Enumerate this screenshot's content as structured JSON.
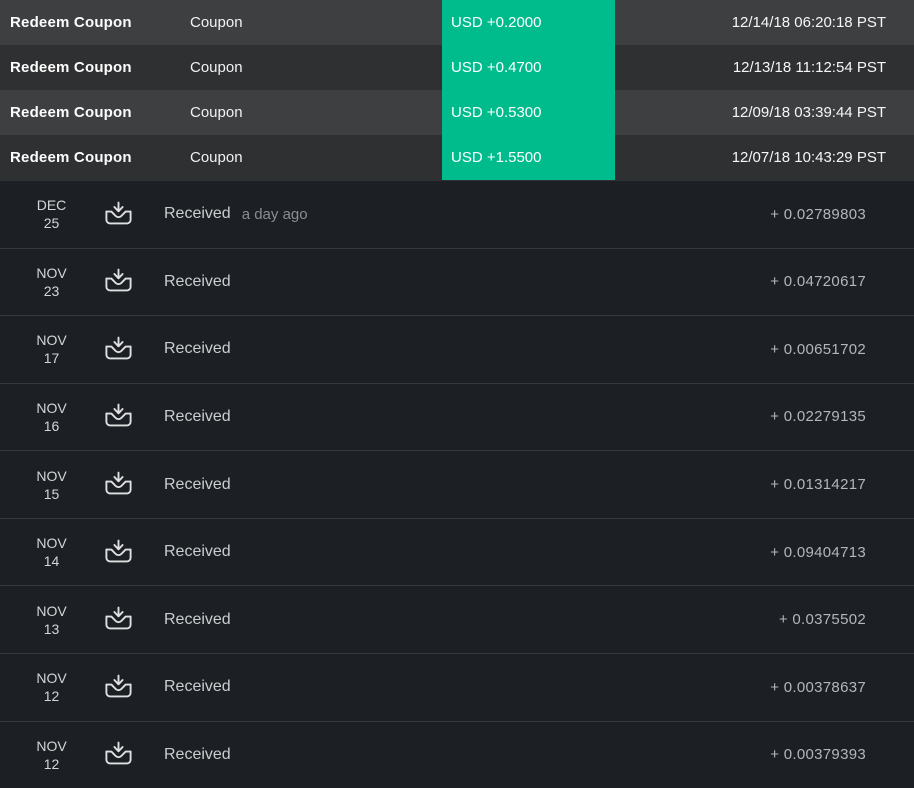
{
  "coupon_rows": [
    {
      "action": "Redeem Coupon",
      "type": "Coupon",
      "amount": "USD +0.2000",
      "timestamp": "12/14/18 06:20:18 PST"
    },
    {
      "action": "Redeem Coupon",
      "type": "Coupon",
      "amount": "USD +0.4700",
      "timestamp": "12/13/18 11:12:54 PST"
    },
    {
      "action": "Redeem Coupon",
      "type": "Coupon",
      "amount": "USD +0.5300",
      "timestamp": "12/09/18 03:39:44 PST"
    },
    {
      "action": "Redeem Coupon",
      "type": "Coupon",
      "amount": "USD +1.5500",
      "timestamp": "12/07/18 10:43:29 PST"
    }
  ],
  "transactions": [
    {
      "month": "DEC",
      "day": "25",
      "label": "Received",
      "relative_time": "a day ago",
      "amount": "+ 0.02789803"
    },
    {
      "month": "NOV",
      "day": "23",
      "label": "Received",
      "relative_time": "",
      "amount": "+ 0.04720617"
    },
    {
      "month": "NOV",
      "day": "17",
      "label": "Received",
      "relative_time": "",
      "amount": "+ 0.00651702"
    },
    {
      "month": "NOV",
      "day": "16",
      "label": "Received",
      "relative_time": "",
      "amount": "+ 0.02279135"
    },
    {
      "month": "NOV",
      "day": "15",
      "label": "Received",
      "relative_time": "",
      "amount": "+ 0.01314217"
    },
    {
      "month": "NOV",
      "day": "14",
      "label": "Received",
      "relative_time": "",
      "amount": "+ 0.09404713"
    },
    {
      "month": "NOV",
      "day": "13",
      "label": "Received",
      "relative_time": "",
      "amount": "+ 0.0375502"
    },
    {
      "month": "NOV",
      "day": "12",
      "label": "Received",
      "relative_time": "",
      "amount": "+ 0.00378637"
    },
    {
      "month": "NOV",
      "day": "12",
      "label": "Received",
      "relative_time": "",
      "amount": "+ 0.00379393"
    }
  ],
  "colors": {
    "accent_green": "#00bc8c",
    "coupon_row_light": "#3e3f41",
    "coupon_row_dark": "#2f3032",
    "list_background": "#1c1f23"
  },
  "icons": {
    "receive_icon": "arrow-down-into-tray"
  }
}
